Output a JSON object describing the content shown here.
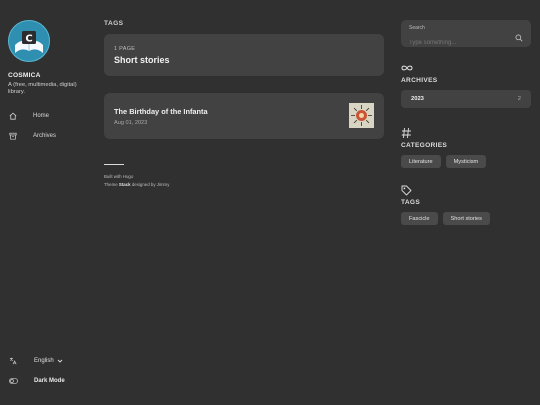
{
  "site": {
    "name": "COSMICA",
    "description": "A (free, multimedia, digital) library."
  },
  "nav": [
    {
      "label": "Home",
      "icon": "home-icon"
    },
    {
      "label": "Archives",
      "icon": "archive-icon"
    }
  ],
  "language": {
    "label": "English"
  },
  "dark_mode": {
    "label": "Dark Mode"
  },
  "main": {
    "section_title": "TAGS",
    "tag_card": {
      "count_label": "1 PAGE",
      "name": "Short stories"
    },
    "article": {
      "title": "The Birthday of the Infanta",
      "date": "Aug 01, 2023"
    },
    "footer": {
      "line1": "Built with Hugo",
      "line2_prefix": "Theme ",
      "line2_theme": "Stack",
      "line2_suffix": " designed by Jimmy"
    }
  },
  "sidebar_right": {
    "search": {
      "label": "Search",
      "placeholder": "Type something..."
    },
    "archives": {
      "title": "ARCHIVES",
      "items": [
        {
          "year": "2023",
          "count": "2"
        }
      ]
    },
    "categories": {
      "title": "CATEGORIES",
      "items": [
        "Literature",
        "Mysticism"
      ]
    },
    "tags": {
      "title": "TAGS",
      "items": [
        "Fascicle",
        "Short stories"
      ]
    }
  },
  "colors": {
    "background": "#303030",
    "card": "#424242",
    "avatar": "#2f8fb1"
  }
}
